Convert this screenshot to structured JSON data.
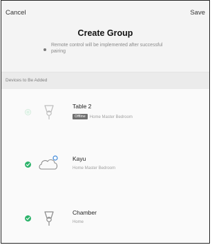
{
  "navbar": {
    "cancel_label": "Cancel",
    "save_label": "Save"
  },
  "title": "Create Group",
  "hint": "Remote control will be implemented after successful pairing",
  "section_label": "Devices to Be Added",
  "colors": {
    "accent_green": "#2db36b",
    "icon_blue": "#3a86d8"
  },
  "devices": [
    {
      "name": "Table 2",
      "badge": "Offline",
      "location": "Home Master Bedroom",
      "icon": "bulb-icon",
      "selected": false
    },
    {
      "name": "Kayu",
      "location": "Home Master Bedroom",
      "icon": "cloud-light-icon",
      "selected": true
    },
    {
      "name": "Chamber",
      "location": "Home",
      "icon": "bulb-icon",
      "selected": true
    }
  ]
}
